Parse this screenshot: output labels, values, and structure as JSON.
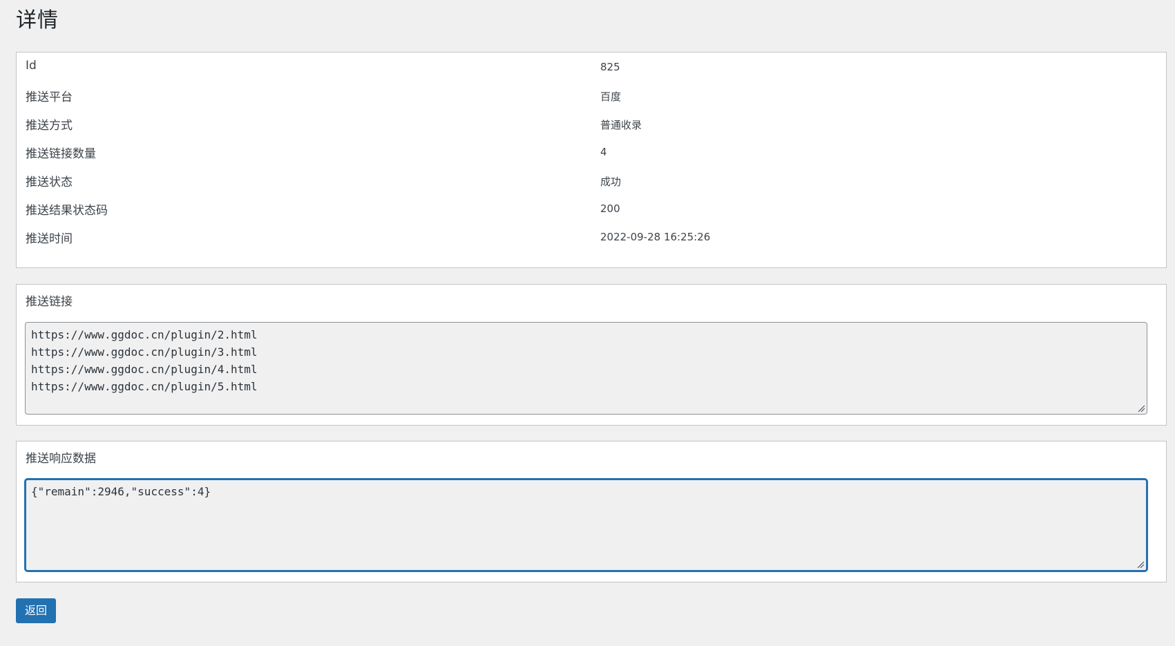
{
  "page": {
    "title": "详情"
  },
  "info": {
    "rows": [
      {
        "label": "Id",
        "value": "825"
      },
      {
        "label": "推送平台",
        "value": "百度"
      },
      {
        "label": "推送方式",
        "value": "普通收录"
      },
      {
        "label": "推送链接数量",
        "value": "4"
      },
      {
        "label": "推送状态",
        "value": "成功"
      },
      {
        "label": "推送结果状态码",
        "value": "200"
      },
      {
        "label": "推送时间",
        "value": "2022-09-28 16:25:26"
      }
    ]
  },
  "links": {
    "label": "推送链接",
    "lines": [
      "https://www.ggdoc.cn/plugin/2.html",
      "https://www.ggdoc.cn/plugin/3.html",
      "https://www.ggdoc.cn/plugin/4.html",
      "https://www.ggdoc.cn/plugin/5.html"
    ]
  },
  "response": {
    "label": "推送响应数据",
    "lines": [
      "{\"remain\":2946,\"success\":4}"
    ]
  },
  "actions": {
    "back_label": "返回"
  },
  "colors": {
    "background": "#f0f0f1",
    "card": "#ffffff",
    "border": "#c3c4c7",
    "accent": "#2271b1",
    "text": "#3c434a"
  },
  "icons": {
    "resize": "resize-grip-icon"
  }
}
